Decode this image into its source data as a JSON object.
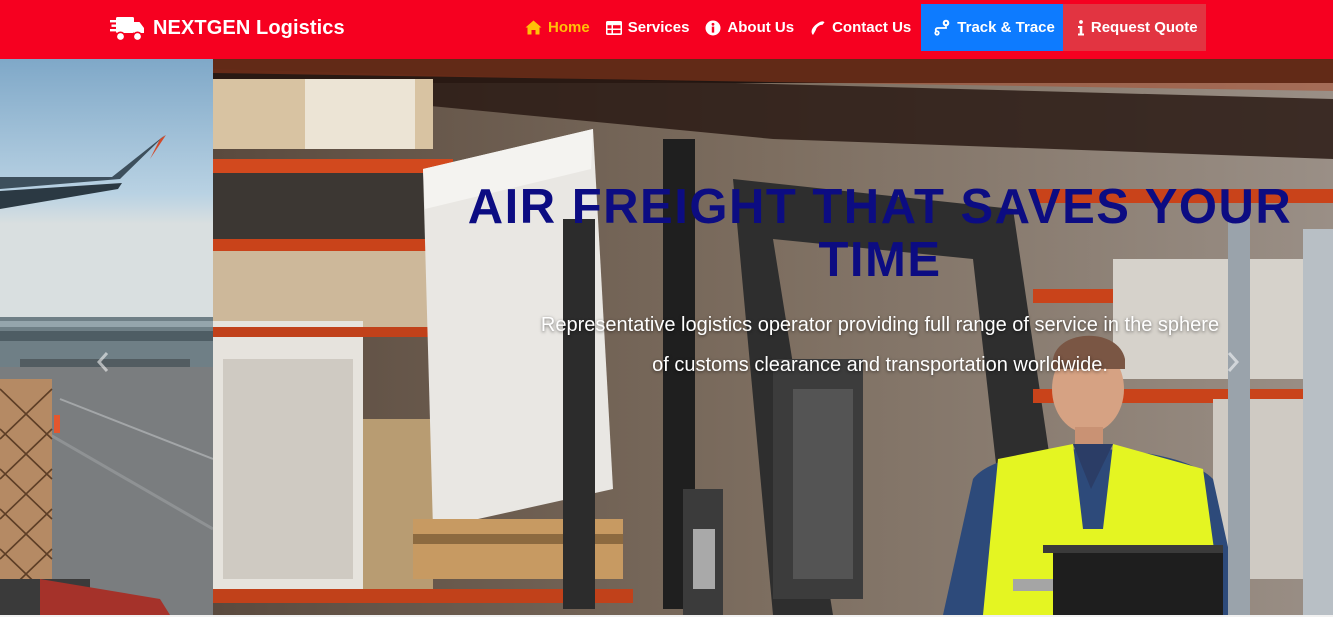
{
  "brand": {
    "name": "NEXTGEN Logistics",
    "icon": "truck-icon"
  },
  "nav": {
    "items": [
      {
        "label": "Home",
        "icon": "home-icon",
        "active": true
      },
      {
        "label": "Services",
        "icon": "table-icon",
        "active": false
      },
      {
        "label": "About Us",
        "icon": "info-circle-icon",
        "active": false
      },
      {
        "label": "Contact Us",
        "icon": "phone-icon",
        "active": false
      },
      {
        "label": "Track & Trace",
        "icon": "route-icon",
        "active": false
      },
      {
        "label": "Request Quote",
        "icon": "info-icon",
        "active": false
      }
    ]
  },
  "hero": {
    "title": "AIR FREIGHT THAT SAVES YOUR TIME",
    "subtitle": "Representative logistics operator providing full range of service in the sphere of customs clearance and transportation worldwide."
  },
  "colors": {
    "navbar": "#f60020",
    "active_link": "#ffc107",
    "track_button": "#0d7bff",
    "quote_button": "#e23441",
    "hero_title": "#0c0c82"
  }
}
